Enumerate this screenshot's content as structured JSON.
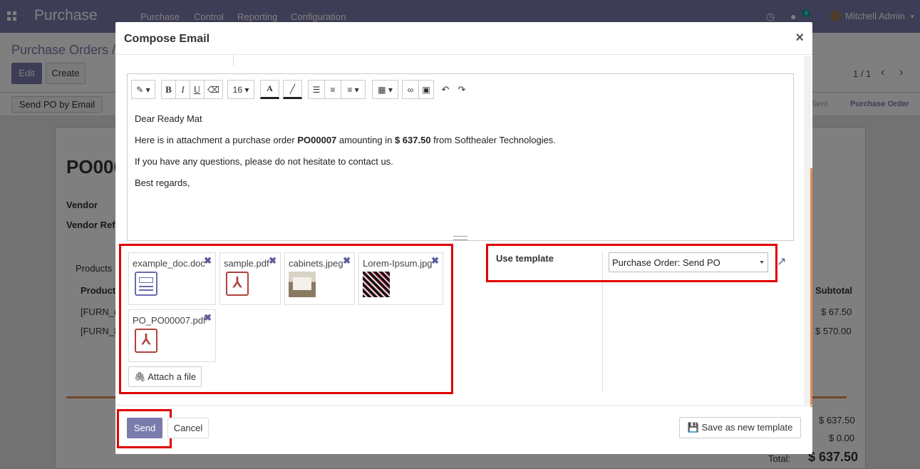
{
  "app": {
    "title": "Purchase",
    "menu": [
      "Purchase",
      "Control",
      "Reporting",
      "Configuration"
    ],
    "notif_count": "4",
    "user": "Mitchell Admin"
  },
  "background": {
    "breadcrumb": "Purchase Orders /",
    "edit_label": "Edit",
    "create_label": "Create",
    "pager": "1 / 1",
    "send_po_label": "Send PO by Email",
    "status_sent": "Sent",
    "status_po": "Purchase Order",
    "po_number": "PO000",
    "vendor_label": "Vendor",
    "vendor_ref_label": "Vendor Ref",
    "products_tab": "Products",
    "product_col": "Product",
    "subtotal_col": "Subtotal",
    "row1_prod": "[FURN_(",
    "row1_sub": "$ 67.50",
    "row2_prod": "[FURN_8",
    "row2_sub": "$ 570.00",
    "untaxed": "$ 637.50",
    "taxes": "$ 0.00",
    "total_label": "Total:",
    "total": "$ 637.50"
  },
  "dialog": {
    "title": "Compose Email",
    "close": "×",
    "toolbar": {
      "font_size": "16",
      "bold": "B",
      "italic": "I",
      "underline": "U"
    },
    "body": {
      "greeting": "Dear Ready Mat",
      "line1_pre": "Here is in attachment a purchase order ",
      "po": "PO00007",
      "line1_mid": " amounting in ",
      "amount": "$ 637.50",
      "line1_post": " from Softhealer Technologies.",
      "line2": "If you have any questions, please do not hesitate to contact us.",
      "line3": "Best regards,"
    },
    "attachments": [
      {
        "name": "example_doc.doc",
        "type": "doc"
      },
      {
        "name": "sample.pdf",
        "type": "pdf"
      },
      {
        "name": "cabinets.jpeg",
        "type": "image"
      },
      {
        "name": "Lorem-Ipsum.jpg",
        "type": "image"
      },
      {
        "name": "PO_PO00007.pdf",
        "type": "pdf"
      }
    ],
    "attach_label": "Attach a file",
    "template_label": "Use template",
    "template_value": "Purchase Order: Send PO",
    "send_label": "Send",
    "cancel_label": "Cancel",
    "save_template_label": "Save as new template"
  },
  "colors": {
    "brand": "#7c7bad",
    "highlight": "#e00000",
    "accent": "#e28d55"
  }
}
